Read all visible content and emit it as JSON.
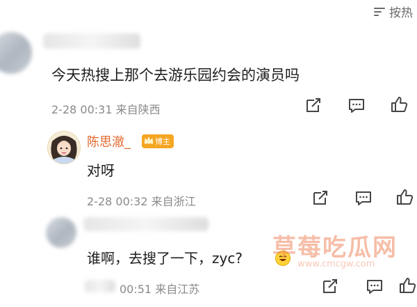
{
  "sort": {
    "label": "按热",
    "icon": "sort-lines-icon"
  },
  "comment": {
    "text": "今天热搜上那个去游乐园约会的演员吗",
    "meta": "2-28 00:31 来自陕西"
  },
  "reply1": {
    "author": "陈思澈_",
    "badge": "博主",
    "text": "对呀",
    "meta": "2-28 00:32 来自浙江"
  },
  "reply2": {
    "text": "谁啊，去搜了一下，zyc?",
    "meta": "00:51 来自江苏"
  },
  "watermark": {
    "main": "草莓吃瓜网",
    "sub": "www.cmcgw.com"
  },
  "icons": [
    "share-icon",
    "comment-icon",
    "like-icon"
  ]
}
